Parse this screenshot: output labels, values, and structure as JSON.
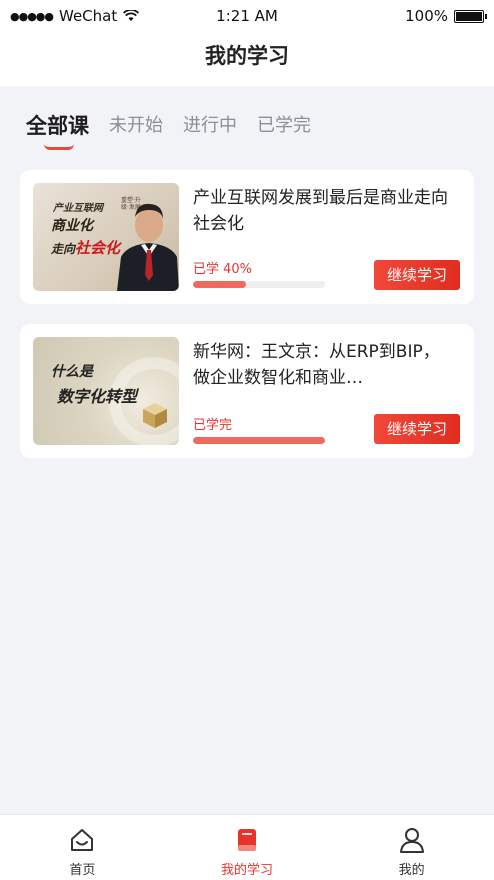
{
  "status_bar": {
    "signal_dots": "●●●●●",
    "carrier": "WeChat",
    "time": "1:21 AM",
    "battery": "100%"
  },
  "nav": {
    "title": "我的学习"
  },
  "tabs": [
    {
      "label": "全部课",
      "active": true
    },
    {
      "label": "未开始",
      "active": false
    },
    {
      "label": "进行中",
      "active": false
    },
    {
      "label": "已学完",
      "active": false
    }
  ],
  "courses": [
    {
      "title": "产业互联网发展到最后是商业走向社会化",
      "progress_label": "已学 40%",
      "progress": 0.4,
      "button": "继续学习",
      "thumb": {
        "line1": "产业互联网",
        "small": "重塑·升级·发展",
        "line2": "商业化",
        "line3_prefix": "走向",
        "line3_highlight": "社会化"
      }
    },
    {
      "title": "新华网：王文京：从ERP到BIP，做企业数智化和商业…",
      "progress_label": "已学完",
      "progress": 1.0,
      "button": "继续学习",
      "thumb": {
        "line1": "什么是",
        "line2": "数字化转型"
      }
    }
  ],
  "tabbar": [
    {
      "label": "首页",
      "icon": "home-icon",
      "active": false
    },
    {
      "label": "我的学习",
      "icon": "book-icon",
      "active": true
    },
    {
      "label": "我的",
      "icon": "user-icon",
      "active": false
    }
  ],
  "colors": {
    "accent": "#e5352b",
    "progress_fill": "#ee6a5c",
    "background": "#f1f3f7"
  }
}
